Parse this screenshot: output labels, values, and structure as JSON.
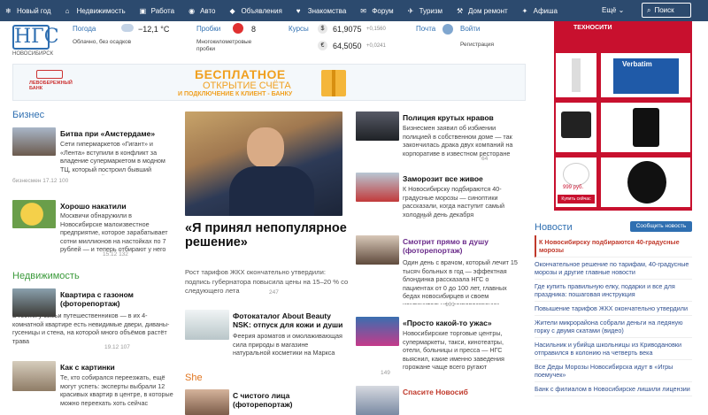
{
  "topnav": {
    "items": [
      {
        "label": "Новый год",
        "icon": "snowflake-icon"
      },
      {
        "label": "Недвижимость",
        "icon": "house-icon"
      },
      {
        "label": "Работа",
        "icon": "briefcase-icon"
      },
      {
        "label": "Авто",
        "icon": "car-icon"
      },
      {
        "label": "Объявления",
        "icon": "tag-icon"
      },
      {
        "label": "Знакомства",
        "icon": "heart-icon"
      },
      {
        "label": "Форум",
        "icon": "chat-icon"
      },
      {
        "label": "Туризм",
        "icon": "plane-icon"
      },
      {
        "label": "Дом ремонт",
        "icon": "hammer-icon"
      },
      {
        "label": "Афиша",
        "icon": "ticket-icon"
      }
    ],
    "more": "Ещё ⌄",
    "search": "Поиск"
  },
  "logo": {
    "text": "НГС",
    "city": "НОВОСИБИРСК"
  },
  "widgets": {
    "weather": {
      "label": "Погода",
      "temp": "−12,1 °С",
      "desc": "Облачно, без осадков"
    },
    "traffic": {
      "label": "Пробки",
      "score": "8",
      "desc": "Многокилометровые пробки"
    },
    "rates": {
      "label": "Курсы",
      "usd": "61,9075",
      "usd_delta": "+0,1560",
      "eur": "64,5050",
      "eur_delta": "+0,0241"
    },
    "mail": {
      "label": "Почта",
      "login": "Войти",
      "register": "Регистрация"
    }
  },
  "banner": {
    "bank": "ЛЕВОБЕРЕЖНЫЙ БАНК",
    "line1": "БЕСПЛАТНОЕ",
    "line2": "ОТКРЫТИЕ СЧЁТА",
    "line3": "И ПОДКЛЮЧЕНИЕ К КЛИЕНТ - БАНКУ"
  },
  "ad": {
    "brand": "ТЕХНОСИТИ",
    "verbatim": "Verbatim",
    "price": "999 руб.",
    "buy": "Купить сейчас"
  },
  "business": {
    "heading": "Бизнес",
    "items": [
      {
        "title": "Битва при «Амстердаме»",
        "text": "Сети гипермаркетов «Гигант» и «Лента» вступили в конфликт за владение супермаркетом в модном ТЦ, который построил бывший «авторитетный»",
        "meta": "бизнесмен   17.12   100"
      },
      {
        "title": "Хорошо накатили",
        "text": "Москвичи обнаружили в Новосибирске малоизвестное предприятие, которое зарабатывает сотни миллионов на настойках по 7 рублей — и теперь отбирают у него эти деньги",
        "meta": "15.12   132"
      }
    ]
  },
  "realty": {
    "heading": "Недвижимость",
    "items": [
      {
        "title": "Квартира с газоном (фоторепортаж)",
        "text": "В гостях у семьи путешественников — в их 4-комнатной квартире есть невидимые двери, диваны-гусеницы и стена, на которой много объёмов растёт трава",
        "meta": "19.12   107"
      },
      {
        "title": "Как с картинки",
        "text": "Те, кто собирался переезжать, ещё могут успеть: эксперты выбрали 12 красивых квартир в центре, в которые можно переехать хоть сейчас",
        "meta": "19.12   86"
      }
    ]
  },
  "main": {
    "title": "«Я принял непопулярное решение»",
    "text": "Рост тарифов ЖКХ окончательно утвердили: подпись губернатора повысила цены на 15–20 % со следующего лета",
    "meta": "247",
    "sub": {
      "title": "Фотокаталог About Beauty NSK: отпуск для кожи и души",
      "text": "Феерия ароматов и омолаживающая сила природы в магазине натуральной косметики на Маркса"
    },
    "she_heading": "She",
    "she_item": {
      "title": "С чистого лица (фоторепортаж)"
    }
  },
  "mid": {
    "items": [
      {
        "title": "Полиция крутых нравов",
        "text": "Бизнесмен заявил об избиении полицией в собственном доме — так закончилась драка двух компаний на корпоративе в известном ресторане",
        "meta": "64"
      },
      {
        "title": "Заморозит все живое",
        "text": "К Новосибирску подбираются 40-градусные морозы — синоптики рассказали, когда наступит самый холодный день декабря",
        "meta": "176"
      },
      {
        "title": "Смотрит прямо в душу (фоторепортаж)",
        "text": "Один день с врачом, который лечит 15 тысяч больных в год — эффектная блондинка рассказала НГС о пациентах от 0 до 100 лет, главных бедах новосибирцев и своем исключительном мировоззрении",
        "meta": "101"
      },
      {
        "title": "«Просто какой-то ужас»",
        "text": "Новосибирские торговые центры, супермаркеты, такси, кинотеатры, отели, больницы и пресса — НГС выяснил, какие именно заведения горожане чаще всего ругают",
        "meta": "149"
      },
      {
        "title": "Спасите Новосиб"
      }
    ]
  },
  "news": {
    "heading": "Новости",
    "report": "Сообщить новость",
    "items": [
      "К Новосибирску подбираются 40-градусные морозы",
      "Окончательное решение по тарифам, 40-градусные морозы и другие главные новости",
      "Где купить правильную елку, подарки и все для праздника: пошаговая инструкция",
      "Повышение тарифов ЖКХ окончательно утвердили",
      "Жители микрорайона собрали деньги на ледяную горку с двумя скатами (видео)",
      "Насильник и убийца школьницы из Криводановки отправился в колонию на четверть века",
      "Все Деды Морозы Новосибирска идут в «Игры поемучек»",
      "Банк с филиалом в Новосибирске лишили лицензии"
    ]
  },
  "colors": {
    "nav": "#2c4a6e",
    "accent": "#2f6fb1",
    "green": "#3b9a3b",
    "orange": "#e0751f",
    "ad_red": "#c8102e"
  }
}
